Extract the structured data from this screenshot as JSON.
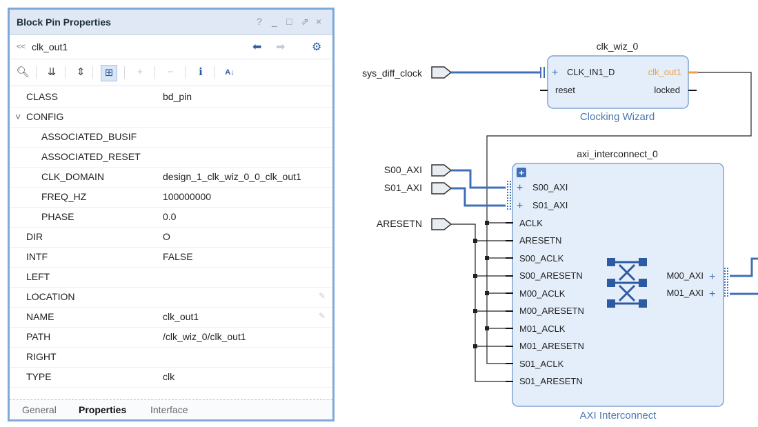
{
  "panel": {
    "title": "Block Pin Properties",
    "window_controls": [
      "?",
      "_",
      "□",
      "⇗",
      "×"
    ],
    "object_name": "clk_out1",
    "rows": [
      {
        "key": "CLASS",
        "value": "bd_pin"
      },
      {
        "key": "CONFIG",
        "value": ""
      },
      {
        "key": "ASSOCIATED_BUSIF",
        "value": ""
      },
      {
        "key": "ASSOCIATED_RESET",
        "value": ""
      },
      {
        "key": "CLK_DOMAIN",
        "value": "design_1_clk_wiz_0_0_clk_out1"
      },
      {
        "key": "FREQ_HZ",
        "value": "100000000"
      },
      {
        "key": "PHASE",
        "value": "0.0"
      },
      {
        "key": "DIR",
        "value": "O"
      },
      {
        "key": "INTF",
        "value": "FALSE"
      },
      {
        "key": "LEFT",
        "value": ""
      },
      {
        "key": "LOCATION",
        "value": ""
      },
      {
        "key": "NAME",
        "value": "clk_out1"
      },
      {
        "key": "PATH",
        "value": "/clk_wiz_0/clk_out1"
      },
      {
        "key": "RIGHT",
        "value": ""
      },
      {
        "key": "TYPE",
        "value": "clk"
      }
    ],
    "tabs": [
      "General",
      "Properties",
      "Interface"
    ]
  },
  "diagram": {
    "ports": {
      "sys_diff_clock": "sys_diff_clock",
      "s00": "S00_AXI",
      "s01": "S01_AXI",
      "aresetn": "ARESETN"
    },
    "clk_wiz": {
      "instance": "clk_wiz_0",
      "caption": "Clocking Wizard",
      "in_pins": [
        "CLK_IN1_D",
        "reset"
      ],
      "out_pins": [
        "clk_out1",
        "locked"
      ]
    },
    "interconnect": {
      "instance": "axi_interconnect_0",
      "caption": "AXI Interconnect",
      "in_pins": [
        "S00_AXI",
        "S01_AXI",
        "ACLK",
        "ARESETN",
        "S00_ACLK",
        "S00_ARESETN",
        "M00_ACLK",
        "M00_ARESETN",
        "M01_ACLK",
        "M01_ARESETN",
        "S01_ACLK",
        "S01_ARESETN"
      ],
      "out_pins": [
        "M00_AXI",
        "M01_AXI"
      ]
    },
    "colors": {
      "bus": "#3f6fb6",
      "block_fill": "#e4eefb",
      "block_border": "#7fa3d1",
      "selected_pin": "#f0a040"
    }
  }
}
